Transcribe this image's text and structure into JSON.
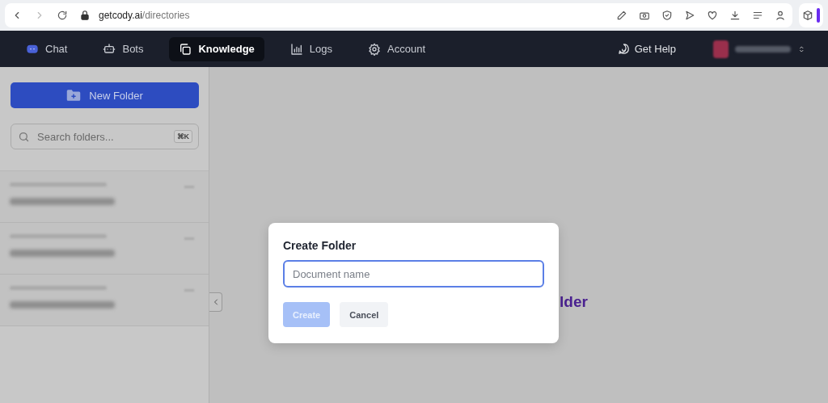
{
  "browser": {
    "url_host": "getcody.ai",
    "url_path": "/directories"
  },
  "nav": {
    "tabs": [
      {
        "label": "Chat",
        "selected": false
      },
      {
        "label": "Bots",
        "selected": false
      },
      {
        "label": "Knowledge",
        "selected": true
      },
      {
        "label": "Logs",
        "selected": false
      },
      {
        "label": "Account",
        "selected": false
      }
    ],
    "help": "Get Help"
  },
  "sidebar": {
    "new_folder": "New Folder",
    "search": {
      "placeholder": "Search folders...",
      "shortcut": "⌘K"
    }
  },
  "main": {
    "heading_fragment": "lder"
  },
  "dialog": {
    "title": "Create Folder",
    "input": {
      "placeholder": "Document name"
    },
    "buttons": [
      {
        "label": "Create",
        "disabled": true
      },
      {
        "label": "Cancel",
        "disabled": false
      }
    ]
  }
}
